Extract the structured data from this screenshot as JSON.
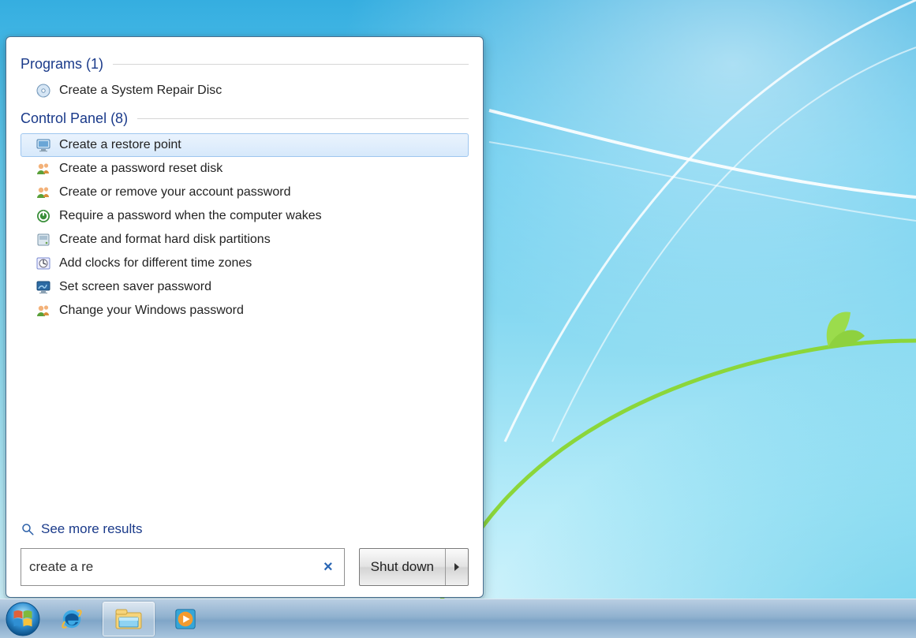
{
  "sections": {
    "programs": {
      "label": "Programs (1)",
      "items": [
        {
          "icon": "disc-icon",
          "label": "Create a System Repair Disc"
        }
      ]
    },
    "control_panel": {
      "label": "Control Panel (8)",
      "items": [
        {
          "icon": "monitor-icon",
          "label": "Create a restore point",
          "highlight": true
        },
        {
          "icon": "users-icon",
          "label": "Create a password reset disk"
        },
        {
          "icon": "users-icon",
          "label": "Create or remove your account password"
        },
        {
          "icon": "power-icon",
          "label": "Require a password when the computer wakes"
        },
        {
          "icon": "disk-icon",
          "label": "Create and format hard disk partitions"
        },
        {
          "icon": "clock-icon",
          "label": "Add clocks for different time zones"
        },
        {
          "icon": "screensaver-icon",
          "label": "Set screen saver password"
        },
        {
          "icon": "users-icon",
          "label": "Change your Windows password"
        }
      ]
    }
  },
  "see_more_label": "See more results",
  "search": {
    "value": "create a re",
    "clear_glyph": "×"
  },
  "shutdown": {
    "label": "Shut down"
  },
  "taskbar": {
    "buttons": [
      {
        "name": "internet-explorer",
        "active": false
      },
      {
        "name": "file-explorer",
        "active": true
      },
      {
        "name": "media-player",
        "active": false
      }
    ]
  }
}
